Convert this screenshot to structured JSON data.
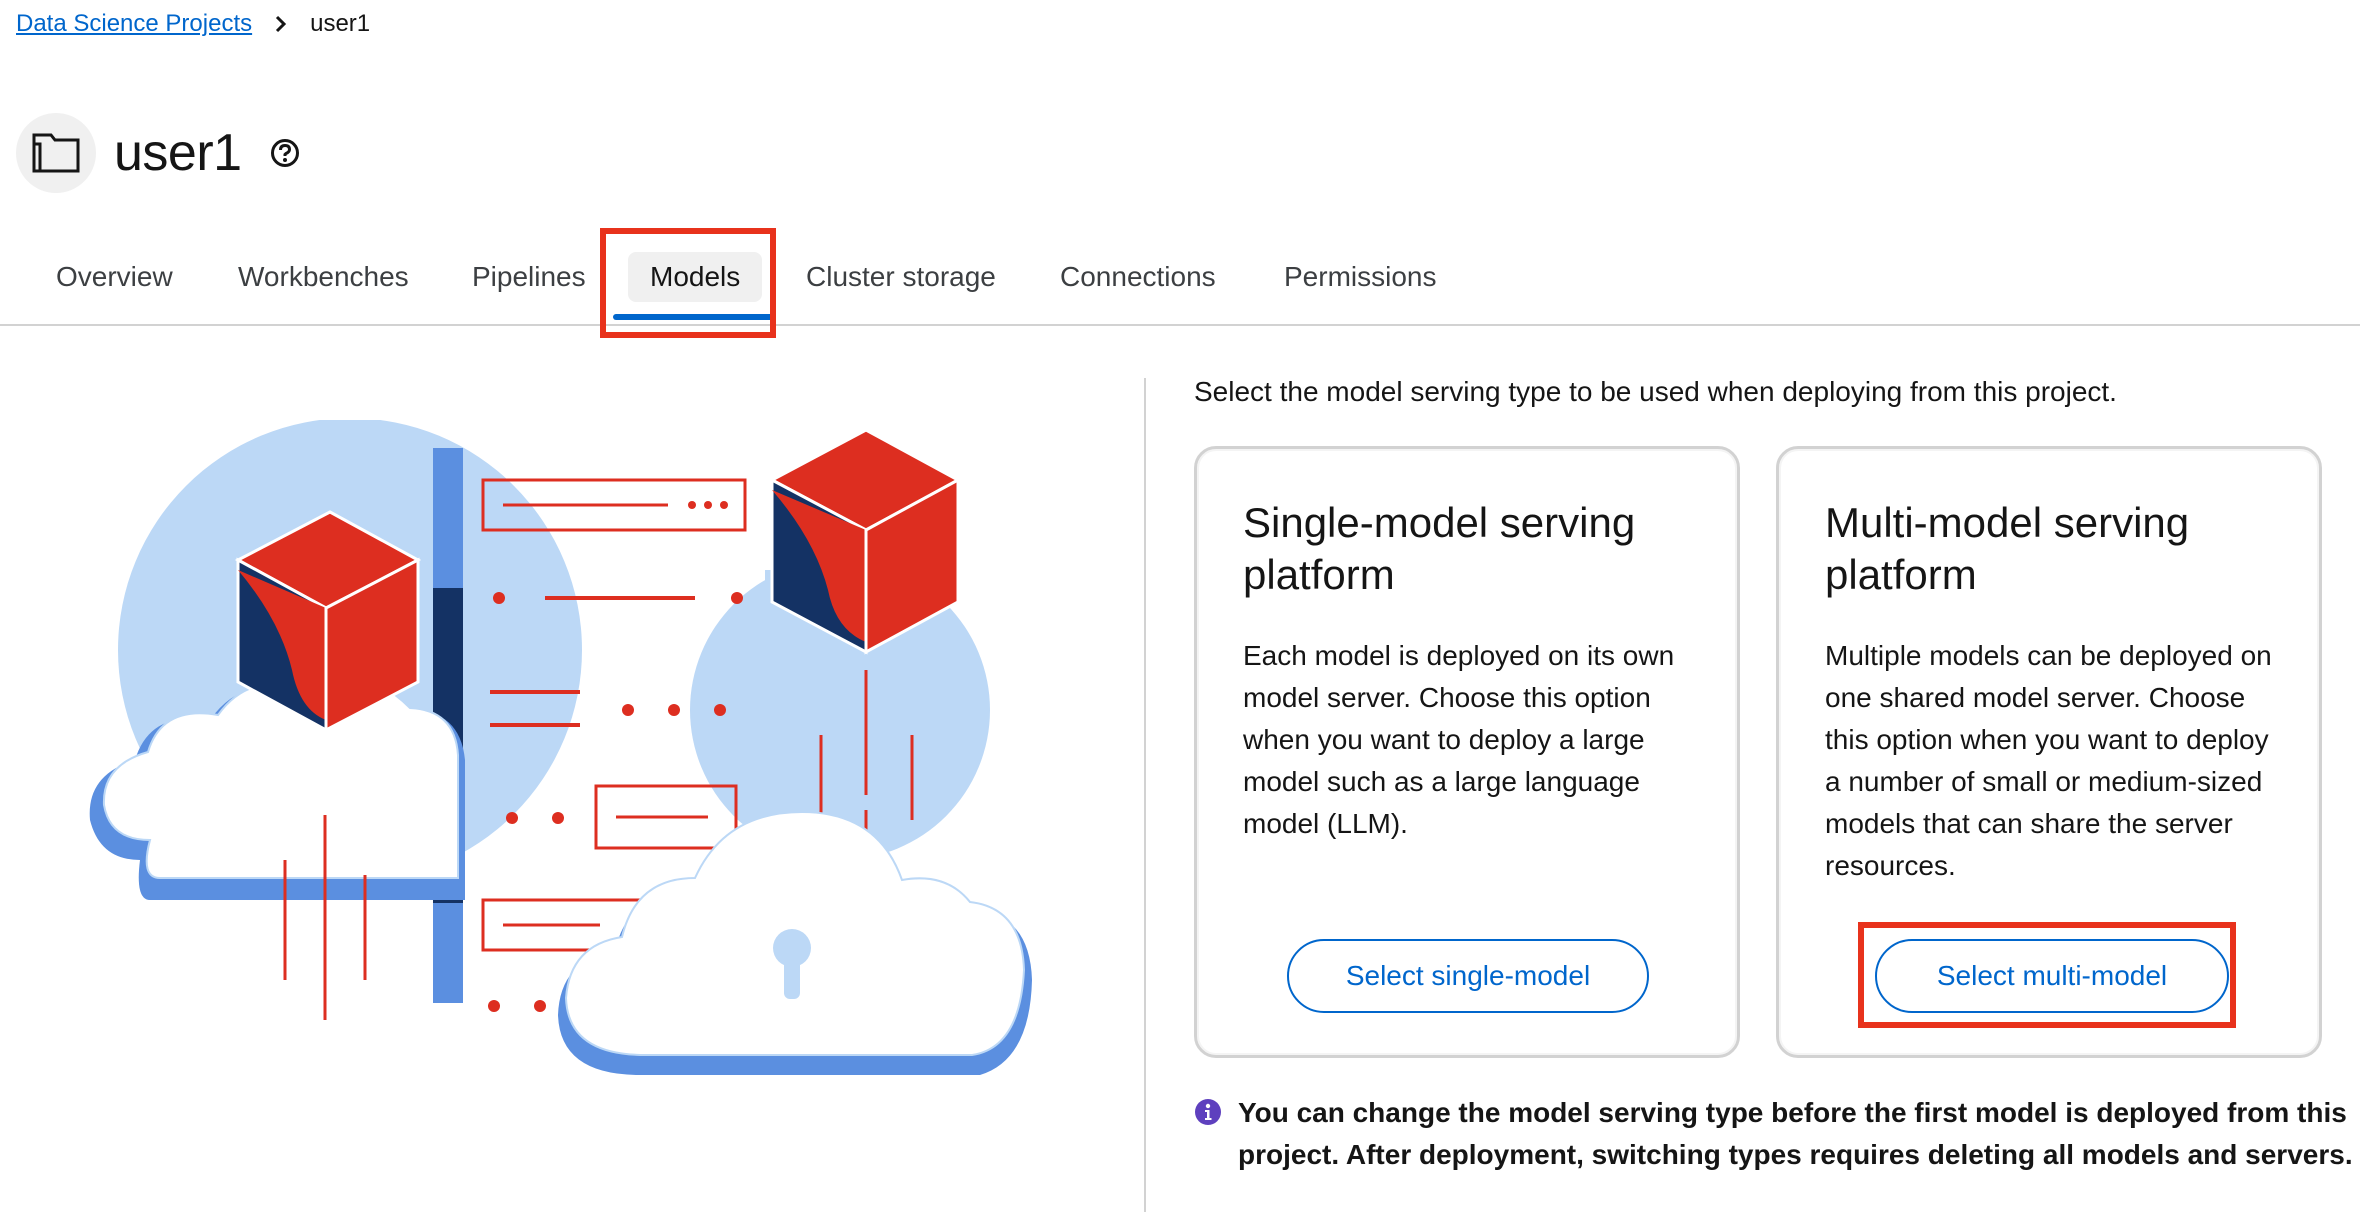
{
  "breadcrumb": {
    "parent": "Data Science Projects",
    "current": "user1"
  },
  "project": {
    "title": "user1"
  },
  "tabs": [
    {
      "label": "Overview"
    },
    {
      "label": "Workbenches"
    },
    {
      "label": "Pipelines"
    },
    {
      "label": "Models"
    },
    {
      "label": "Cluster storage"
    },
    {
      "label": "Connections"
    },
    {
      "label": "Permissions"
    }
  ],
  "active_tab": "Models",
  "main": {
    "intro": "Select the model serving type to be used when deploying from this project.",
    "cards": [
      {
        "title": "Single-model serving platform",
        "description": "Each model is deployed on its own model server. Choose this option when you want to deploy a large model such as a large language model (LLM).",
        "button": "Select single-model"
      },
      {
        "title": "Multi-model serving platform",
        "description": "Multiple models can be deployed on one shared model server. Choose this option when you want to deploy a number of small or medium-sized models that can share the server resources.",
        "button": "Select multi-model"
      }
    ],
    "note": "You can change the model serving type before the first model is deployed from this project. After deployment, switching types requires deleting all models and servers."
  },
  "colors": {
    "link": "#0066cc",
    "highlight": "#e8321c",
    "illustration_red": "#dd2e20",
    "illustration_navy": "#143264",
    "illustration_blue": "#5b8fe0",
    "illustration_light_blue": "#bcd8f6",
    "info_purple": "#5e40be"
  },
  "icons": {
    "breadcrumb_separator": "chevron-right-icon",
    "project": "folder-icon",
    "help": "help-circle-icon",
    "note": "info-circle-icon"
  }
}
